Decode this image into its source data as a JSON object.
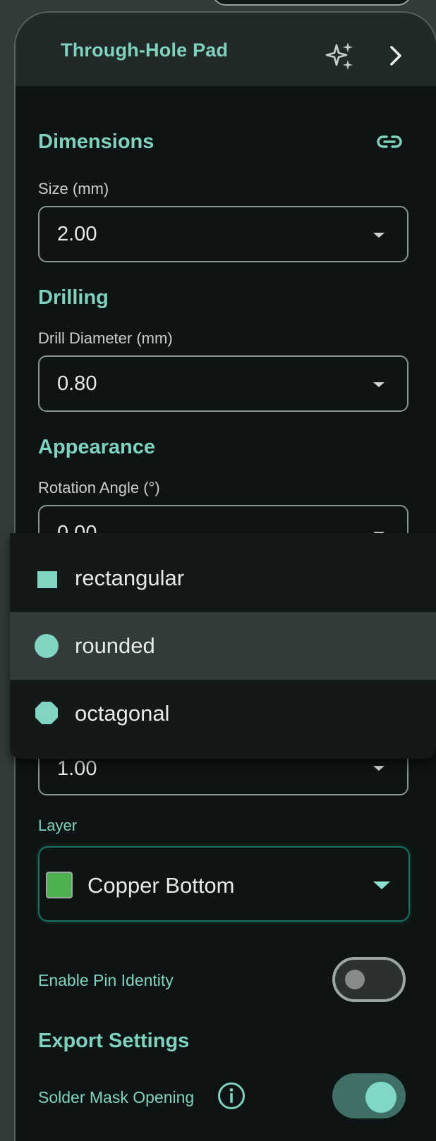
{
  "panel": {
    "title": "Through-Hole Pad"
  },
  "sections": {
    "dimensions": {
      "title": "Dimensions",
      "size_label": "Size (mm)",
      "size_value": "2.00"
    },
    "drilling": {
      "title": "Drilling",
      "drill_label": "Drill Diameter (mm)",
      "drill_value": "0.80"
    },
    "appearance": {
      "title": "Appearance",
      "rotation_label": "Rotation Angle (°)",
      "rotation_value": "0.00",
      "hidden_field_value": "1.00",
      "layer_label": "Layer",
      "layer_value": "Copper Bottom",
      "layer_color": "#4caf50"
    }
  },
  "shape_menu": {
    "items": [
      {
        "label": "rectangular",
        "icon": "square-icon"
      },
      {
        "label": "rounded",
        "icon": "circle-icon",
        "selected": true
      },
      {
        "label": "octagonal",
        "icon": "octagon-icon"
      }
    ]
  },
  "pin_identity": {
    "label": "Enable Pin Identity",
    "enabled": false
  },
  "export": {
    "title": "Export Settings",
    "solder_mask_label": "Solder Mask Opening",
    "solder_mask_enabled": true
  },
  "colors": {
    "accent": "#7fd2c0",
    "panel_bg": "#0e1413",
    "header_bg": "#222a29",
    "selected_item_bg": "#333a3a"
  }
}
